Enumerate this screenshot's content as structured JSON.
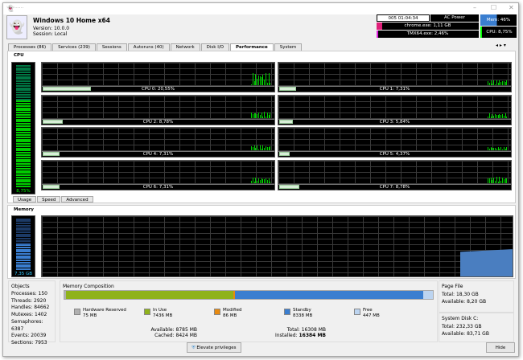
{
  "window": {
    "title": "······"
  },
  "header": {
    "os": "Windows 10 Home x64",
    "version": "Version: 10.0.0",
    "session": "Session: Local",
    "uptime": "005 01:04:34",
    "power": "AC Power",
    "top_mem": "chrome.exe: 1,11 GB",
    "top_cpu": "TMX64.exe: 2,46%",
    "mem": "Mem: 46%",
    "cpu": "CPU: 8,75%"
  },
  "tabs": [
    "Processes (86)",
    "Services (239)",
    "Sessions",
    "Autoruns (40)",
    "Network",
    "Disk I/O",
    "Performance",
    "System"
  ],
  "cpu": {
    "header": "CPU",
    "total": "8,75%",
    "total_value": 8.75,
    "cores": [
      {
        "label": "CPU 0: 20,55%",
        "v": 20.55
      },
      {
        "label": "CPU 1: 7,31%",
        "v": 7.31
      },
      {
        "label": "CPU 2: 8,78%",
        "v": 8.78
      },
      {
        "label": "CPU 3: 5,84%",
        "v": 5.84
      },
      {
        "label": "CPU 4: 7,31%",
        "v": 7.31
      },
      {
        "label": "CPU 5: 4,37%",
        "v": 4.37
      },
      {
        "label": "CPU 6: 7,31%",
        "v": 7.31
      },
      {
        "label": "CPU 7: 8,78%",
        "v": 8.78
      }
    ],
    "subtabs": [
      "Usage",
      "Speed",
      "Advanced"
    ]
  },
  "memory": {
    "header": "Memory",
    "used": "7,35 GB",
    "used_percent": 46
  },
  "objects": {
    "title": "Objects",
    "lines": [
      "Processes: 150",
      "Threads: 2920",
      "Handles: 84662",
      "Mutexes: 1402",
      "Semaphores: 6387",
      "Events: 20039",
      "Sections: 7953"
    ]
  },
  "composition": {
    "title": "Memory Composition",
    "items": [
      {
        "name": "Hardware Reserved",
        "value": "75 MB",
        "mb": 75,
        "color": "#b0b0b0"
      },
      {
        "name": "In Use",
        "value": "7436 MB",
        "mb": 7436,
        "color": "#8fb21a"
      },
      {
        "name": "Modified",
        "value": "86 MB",
        "mb": 86,
        "color": "#e88a10"
      },
      {
        "name": "Standby",
        "value": "8338 MB",
        "mb": 8338,
        "color": "#3a7ed0"
      },
      {
        "name": "Free",
        "value": "447 MB",
        "mb": 447,
        "color": "#bcd4f0"
      }
    ],
    "available": "Available: 8785 MB",
    "cached": "Cached: 8424 MB",
    "total": "Total: 16308 MB",
    "installed_label": "Installed:",
    "installed": "16384 MB"
  },
  "pagefile": {
    "title": "Page File",
    "total": "Total: 18,30 GB",
    "available": "Available: 8,20 GB"
  },
  "disk": {
    "title": "System Disk C:",
    "total": "Total: 232,33 GB",
    "available": "Available: 83,71 GB"
  },
  "buttons": {
    "elevate": "Elevate privileges",
    "hide": "Hide"
  }
}
